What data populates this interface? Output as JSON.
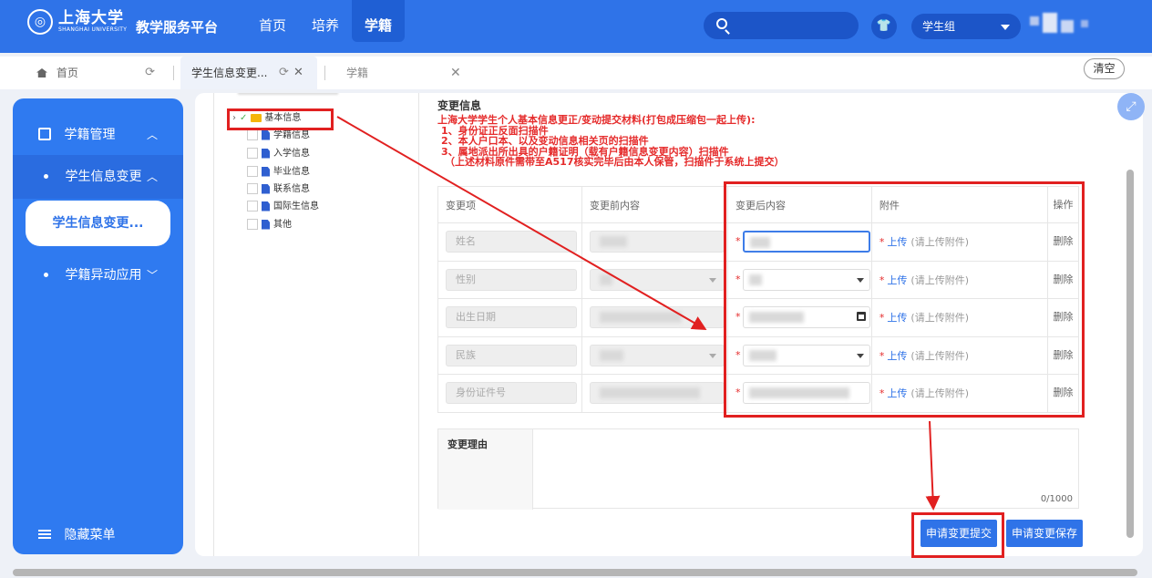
{
  "header": {
    "logo_cn": "上海大学",
    "logo_en": "SHANGHAI UNIVERSITY",
    "platform": "教学服务平台",
    "nav": [
      "首页",
      "培养",
      "学籍"
    ],
    "role": "学生组"
  },
  "tabs": {
    "home": "首页",
    "info": "学生信息变更...",
    "xueji": "学籍",
    "clear": "清空"
  },
  "sidebar": {
    "group": "学籍管理",
    "sub_open": "学生信息变更",
    "active": "学生信息变更...",
    "sub_other": "学籍异动应用",
    "hide": "隐藏菜单"
  },
  "tree": {
    "root": "基本信息",
    "items": [
      "学籍信息",
      "入学信息",
      "毕业信息",
      "联系信息",
      "国际生信息",
      "其他"
    ]
  },
  "form": {
    "section_title": "变更信息",
    "notes": [
      "上海大学学生个人基本信息更正/变动提交材料(打包成压缩包一起上传):",
      "1、身份证正反面扫描件",
      "2、本人户口本、以及变动信息相关页的扫描件",
      "3、属地派出所出具的户籍证明（载有户籍信息变更内容）扫描件",
      "（上述材料原件需带至A517核实完毕后由本人保管，扫描件于系统上提交）"
    ],
    "columns": [
      "变更项",
      "变更前内容",
      "变更后内容",
      "附件",
      "操作"
    ],
    "rows": [
      {
        "item": "姓名"
      },
      {
        "item": "性别"
      },
      {
        "item": "出生日期"
      },
      {
        "item": "民族"
      },
      {
        "item": "身份证件号"
      }
    ],
    "upload_label": "上传",
    "upload_hint": "(请上传附件)",
    "delete_label": "删除",
    "reason_label": "变更理由",
    "reason_count": "0/1000",
    "submit": "申请变更提交",
    "save": "申请变更保存"
  },
  "colors": {
    "primary": "#2f73e8",
    "annotation": "#e12020",
    "note_red": "#e52b2b"
  }
}
